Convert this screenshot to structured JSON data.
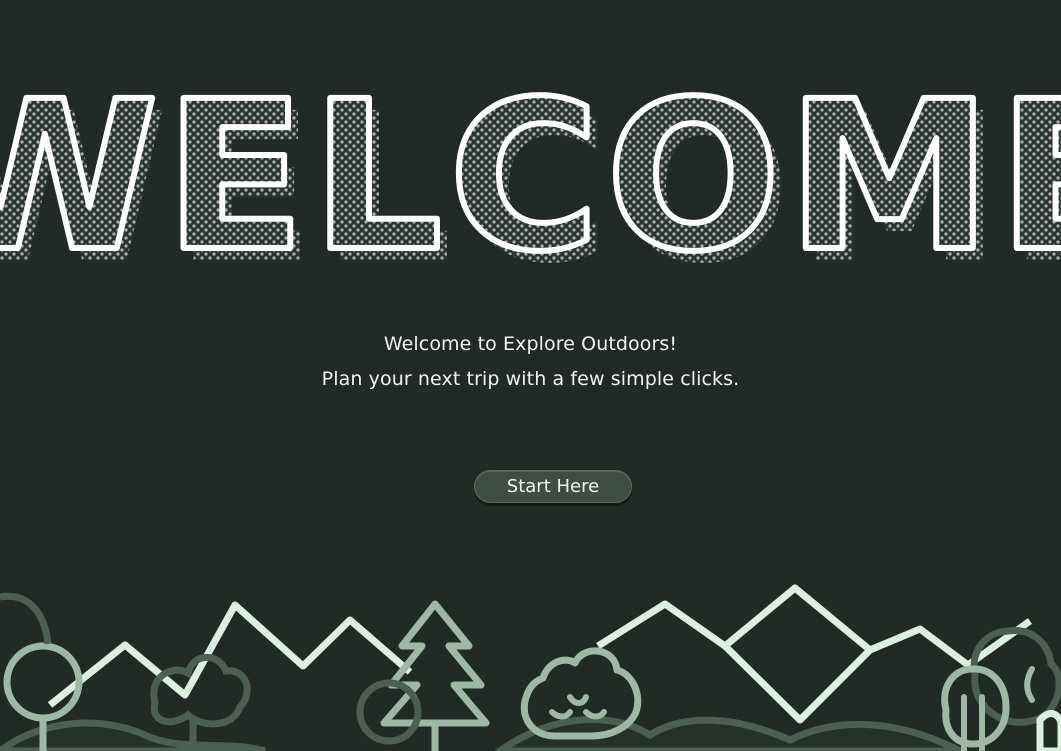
{
  "hero": {
    "title": "WELCOME"
  },
  "intro": {
    "line1": "Welcome to Explore Outdoors!",
    "line2": "Plan your next trip with a few simple clicks."
  },
  "actions": {
    "start_label": "Start Here"
  },
  "colors": {
    "background": "#222a25",
    "text": "#f2f2ee",
    "button": "#3f4d44",
    "mountain": "#dceee0",
    "tree": "#8fa596"
  }
}
